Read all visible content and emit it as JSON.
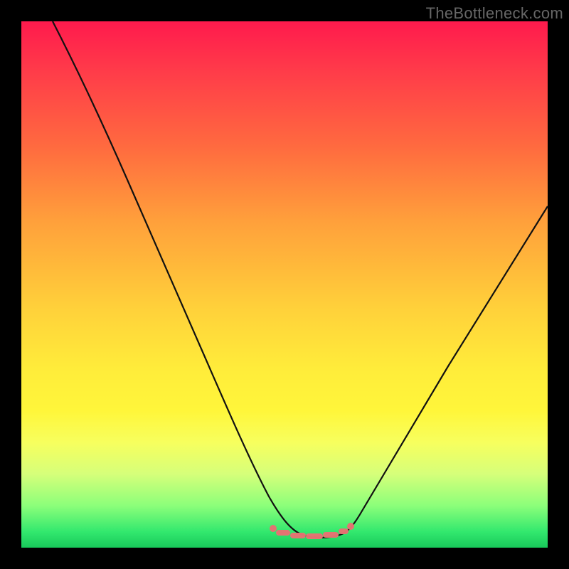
{
  "watermark": "TheBottleneck.com",
  "chart_data": {
    "type": "line",
    "title": "",
    "xlabel": "",
    "ylabel": "",
    "xlim": [
      0,
      100
    ],
    "ylim": [
      0,
      100
    ],
    "grid": false,
    "legend": false,
    "series": [
      {
        "name": "bottleneck-curve",
        "x": [
          6,
          12,
          18,
          24,
          30,
          36,
          42,
          47.5,
          50,
          55,
          60,
          62.5,
          68,
          74,
          80,
          86,
          92,
          100
        ],
        "values": [
          100,
          86,
          72,
          59,
          46,
          34,
          22,
          11,
          5,
          2,
          3,
          6,
          15,
          25,
          35,
          44,
          54,
          65
        ]
      }
    ],
    "annotations": [
      {
        "name": "valley-marker",
        "x_range": [
          48,
          62
        ],
        "y": 3,
        "color": "#e67272"
      }
    ],
    "background_gradient": {
      "orientation": "vertical",
      "stops": [
        {
          "pos": 0.0,
          "color": "#ff1a4d"
        },
        {
          "pos": 0.24,
          "color": "#ff6b3f"
        },
        {
          "pos": 0.55,
          "color": "#ffd23a"
        },
        {
          "pos": 0.86,
          "color": "#d6ff7a"
        },
        {
          "pos": 1.0,
          "color": "#18c95a"
        }
      ]
    }
  }
}
